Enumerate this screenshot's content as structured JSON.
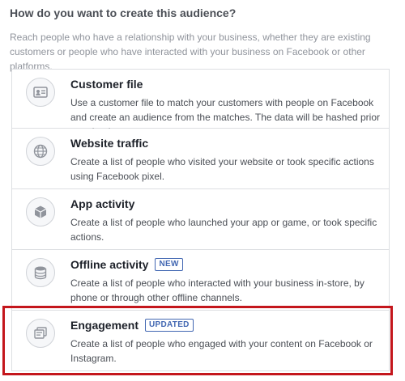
{
  "heading": "How do you want to create this audience?",
  "intro": "Reach people who have a relationship with your business, whether they are existing customers or people who have interacted with your business on Facebook or other platforms.",
  "options": [
    {
      "title": "Customer file",
      "badge": "",
      "description": "Use a customer file to match your customers with people on Facebook and create an audience from the matches. The data will be hashed prior to upload.",
      "icon": "customer-file-icon"
    },
    {
      "title": "Website traffic",
      "badge": "",
      "description": "Create a list of people who visited your website or took specific actions using Facebook pixel.",
      "icon": "globe-icon"
    },
    {
      "title": "App activity",
      "badge": "",
      "description": "Create a list of people who launched your app or game, or took specific actions.",
      "icon": "cube-icon"
    },
    {
      "title": "Offline activity",
      "badge": "NEW",
      "description": "Create a list of people who interacted with your business in-store, by phone or through other offline channels.",
      "icon": "database-icon"
    },
    {
      "title": "Engagement",
      "badge": "UPDATED",
      "description": "Create a list of people who engaged with your content on Facebook or Instagram.",
      "icon": "engagement-icon"
    }
  ],
  "colors": {
    "highlight": "#c4161c",
    "badge": "#4267b2"
  }
}
